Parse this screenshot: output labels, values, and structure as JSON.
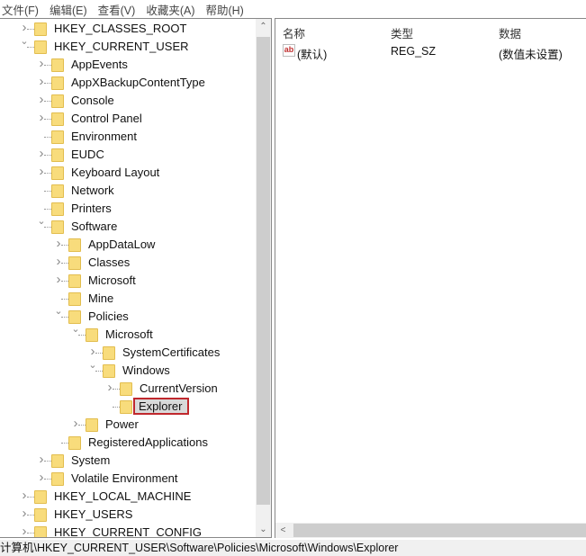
{
  "menu": [
    "文件(F)",
    "编辑(E)",
    "查看(V)",
    "收藏夹(A)",
    "帮助(H)"
  ],
  "tree": [
    {
      "label": "HKEY_CLASSES_ROOT",
      "level": 0,
      "expander": "collapsed"
    },
    {
      "label": "HKEY_CURRENT_USER",
      "level": 0,
      "expander": "expanded"
    },
    {
      "label": "AppEvents",
      "level": 1,
      "expander": "collapsed"
    },
    {
      "label": "AppXBackupContentType",
      "level": 1,
      "expander": "collapsed"
    },
    {
      "label": "Console",
      "level": 1,
      "expander": "collapsed"
    },
    {
      "label": "Control Panel",
      "level": 1,
      "expander": "collapsed"
    },
    {
      "label": "Environment",
      "level": 1,
      "expander": "none"
    },
    {
      "label": "EUDC",
      "level": 1,
      "expander": "collapsed"
    },
    {
      "label": "Keyboard Layout",
      "level": 1,
      "expander": "collapsed"
    },
    {
      "label": "Network",
      "level": 1,
      "expander": "none"
    },
    {
      "label": "Printers",
      "level": 1,
      "expander": "none"
    },
    {
      "label": "Software",
      "level": 1,
      "expander": "expanded"
    },
    {
      "label": "AppDataLow",
      "level": 2,
      "expander": "collapsed"
    },
    {
      "label": "Classes",
      "level": 2,
      "expander": "collapsed"
    },
    {
      "label": "Microsoft",
      "level": 2,
      "expander": "collapsed"
    },
    {
      "label": "Mine",
      "level": 2,
      "expander": "none"
    },
    {
      "label": "Policies",
      "level": 2,
      "expander": "expanded"
    },
    {
      "label": "Microsoft",
      "level": 3,
      "expander": "expanded"
    },
    {
      "label": "SystemCertificates",
      "level": 4,
      "expander": "collapsed"
    },
    {
      "label": "Windows",
      "level": 4,
      "expander": "expanded"
    },
    {
      "label": "CurrentVersion",
      "level": 5,
      "expander": "collapsed"
    },
    {
      "label": "Explorer",
      "level": 5,
      "expander": "none",
      "selected": true
    },
    {
      "label": "Power",
      "level": 3,
      "expander": "collapsed"
    },
    {
      "label": "RegisteredApplications",
      "level": 2,
      "expander": "none"
    },
    {
      "label": "System",
      "level": 1,
      "expander": "collapsed"
    },
    {
      "label": "Volatile Environment",
      "level": 1,
      "expander": "collapsed"
    },
    {
      "label": "HKEY_LOCAL_MACHINE",
      "level": 0,
      "expander": "collapsed"
    },
    {
      "label": "HKEY_USERS",
      "level": 0,
      "expander": "collapsed"
    },
    {
      "label": "HKEY_CURRENT_CONFIG",
      "level": 0,
      "expander": "collapsed"
    }
  ],
  "values": {
    "columns": [
      "名称",
      "类型",
      "数据"
    ],
    "rows": [
      {
        "icon": "ab",
        "name": "(默认)",
        "type": "REG_SZ",
        "data": "(数值未设置)"
      }
    ]
  },
  "statusbar": "计算机\\HKEY_CURRENT_USER\\Software\\Policies\\Microsoft\\Windows\\Explorer",
  "colors": {
    "selection_outline": "#c0282d",
    "folder": "#f8dc7c"
  }
}
